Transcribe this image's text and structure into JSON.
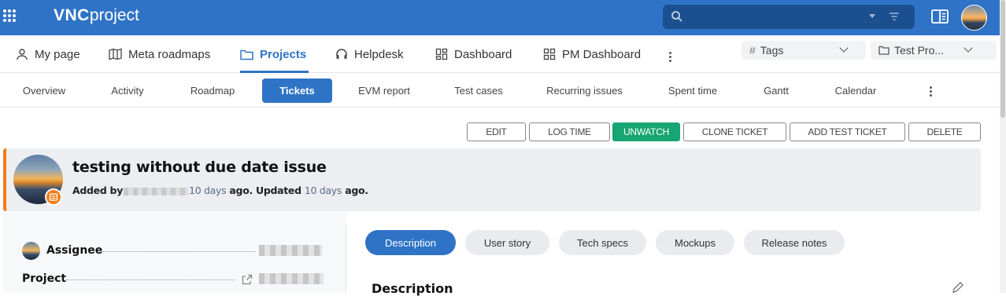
{
  "topbar": {
    "brand_bold": "VNC",
    "brand_light": "project",
    "search_placeholder": "",
    "accent_color": "#2f73c6"
  },
  "main_nav": {
    "items": [
      {
        "label": "My page",
        "icon": "person-icon"
      },
      {
        "label": "Meta roadmaps",
        "icon": "map-icon"
      },
      {
        "label": "Projects",
        "icon": "folder-icon",
        "active": true
      },
      {
        "label": "Helpdesk",
        "icon": "headset-icon"
      },
      {
        "label": "Dashboard",
        "icon": "dashboard-icon"
      },
      {
        "label": "PM Dashboard",
        "icon": "grid-icon"
      }
    ],
    "tags_select": "Tags",
    "project_select": "Test Pro..."
  },
  "sub_nav": {
    "items": [
      "Overview",
      "Activity",
      "Roadmap",
      "Tickets",
      "EVM report",
      "Test cases",
      "Recurring issues",
      "Spent time",
      "Gantt",
      "Calendar"
    ],
    "active": "Tickets"
  },
  "actions": {
    "edit": "EDIT",
    "log_time": "LOG TIME",
    "unwatch": "UNWATCH",
    "clone": "CLONE TICKET",
    "add_test": "ADD TEST TICKET",
    "delete": "DELETE"
  },
  "ticket": {
    "title": "testing without due date issue",
    "added_by_label": "Added by",
    "added_ago": "10 days",
    "ago_updated": "ago. Updated",
    "updated_ago": "10 days",
    "ago_end": "ago.",
    "status_color": "#f07c1a"
  },
  "properties": {
    "assignee_label": "Assignee",
    "project_label": "Project"
  },
  "tabs": [
    "Description",
    "User story",
    "Tech specs",
    "Mockups",
    "Release notes"
  ],
  "description_heading": "Description"
}
